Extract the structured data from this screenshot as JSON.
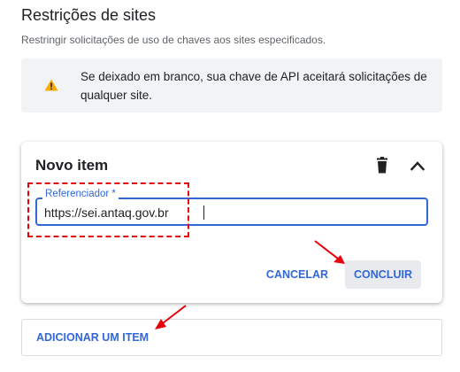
{
  "section": {
    "title": "Restrições de sites",
    "description": "Restringir solicitações de uso de chaves aos sites especificados."
  },
  "warning": {
    "icon": "warning-icon",
    "text": "Se deixado em branco, sua chave de API aceitará solicitações de qualquer site."
  },
  "card": {
    "title": "Novo item",
    "delete_icon": "delete-icon",
    "collapse_icon": "chevron-up-icon",
    "field": {
      "label": "Referenciador *",
      "value": "https://sei.antaq.gov.br"
    },
    "cancel_label": "CANCELAR",
    "done_label": "CONCLUIR"
  },
  "add_item_label": "ADICIONAR UM ITEM",
  "colors": {
    "accent": "#3367d6",
    "annotation": "#e8000b",
    "warning": "#f9ab00",
    "panel": "#f1f3f4"
  }
}
